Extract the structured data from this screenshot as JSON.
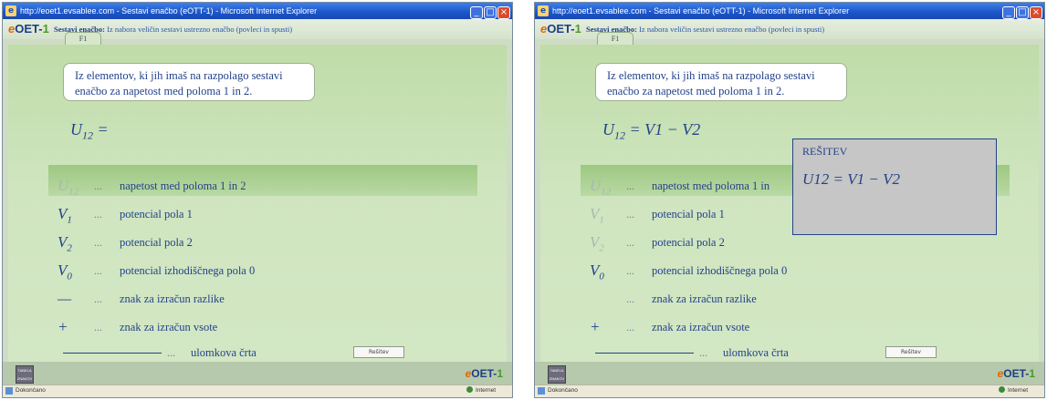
{
  "windows": [
    {
      "title": "http://eoet1.evsablee.com - Sestavi enačbo (eOTT-1) - Microsoft Internet Explorer",
      "header_title_bold": "Sestavi enačbo:",
      "header_title_rest": "Iz nabora veličin sestavi ustrezno enačbo (povleci in spusti)",
      "tab_label": "F1",
      "instruction": "Iz elementov, ki jih imaš na razpolago sestavi enačbo za napetost med poloma 1 in 2.",
      "equation_lhs": "U",
      "equation_lhs_sub": "12",
      "equation_rest": " =",
      "legend": [
        {
          "sym": "U",
          "sub": "12",
          "faded": true,
          "dots": "...",
          "desc": "napetost med poloma 1 in 2"
        },
        {
          "sym": "V",
          "sub": "1",
          "faded": false,
          "dots": "...",
          "desc": "potencial pola 1"
        },
        {
          "sym": "V",
          "sub": "2",
          "faded": false,
          "dots": "...",
          "desc": "potencial pola 2"
        },
        {
          "sym": "V",
          "sub": "0",
          "faded": false,
          "dots": "...",
          "desc": "potencial izhodiščnega pola 0"
        },
        {
          "sym": "—",
          "sub": "",
          "faded": false,
          "dots": "...",
          "desc": "znak za izračun razlike"
        },
        {
          "sym": "+",
          "sub": "",
          "faded": false,
          "dots": "...",
          "desc": "znak za izračun vsote"
        }
      ],
      "fraction_line": {
        "dots": "...",
        "desc": "ulomkova črta"
      },
      "solution_button": "Rešitev",
      "footer_button": "TABELA ZNAKOV",
      "status_left": "Dokončano",
      "status_zone": "Internet"
    },
    {
      "title": "http://eoet1.evsablee.com - Sestavi enačbo (eOTT-1) - Microsoft Internet Explorer",
      "header_title_bold": "Sestavi enačbo:",
      "header_title_rest": "Iz nabora veličin sestavi ustrezno enačbo (povleci in spusti)",
      "tab_label": "F1",
      "instruction": "Iz elementov, ki jih imaš na razpolago sestavi enačbo za napetost med poloma 1 in 2.",
      "equation_lhs": "U",
      "equation_lhs_sub": "12",
      "equation_rest": " = V1 − V2",
      "legend": [
        {
          "sym": "U",
          "sub": "12",
          "faded": true,
          "dots": "...",
          "desc": "napetost med poloma 1 in"
        },
        {
          "sym": "V",
          "sub": "1",
          "faded": true,
          "dots": "...",
          "desc": "potencial pola 1"
        },
        {
          "sym": "V",
          "sub": "2",
          "faded": true,
          "dots": "...",
          "desc": "potencial pola 2"
        },
        {
          "sym": "V",
          "sub": "0",
          "faded": false,
          "dots": "...",
          "desc": "potencial izhodiščnega pola 0"
        },
        {
          "sym": "",
          "sub": "",
          "faded": false,
          "dots": "...",
          "desc": "znak za izračun razlike"
        },
        {
          "sym": "+",
          "sub": "",
          "faded": false,
          "dots": "...",
          "desc": "znak za izračun vsote"
        }
      ],
      "fraction_line": {
        "dots": "...",
        "desc": "ulomkova črta"
      },
      "solution_button": "Rešitev",
      "solution_panel": {
        "title": "REŠITEV",
        "equation": "U12 = V1 − V2"
      },
      "footer_button": "TABELA ZNAKOV",
      "status_left": "Dokončano",
      "status_zone": "Internet"
    }
  ],
  "logo": {
    "e": "e",
    "main": "OET-",
    "one": "1"
  },
  "colors": {
    "accent": "#23428a",
    "title_bar": "#1b55c9",
    "content_bg": "#cfe5bf"
  }
}
